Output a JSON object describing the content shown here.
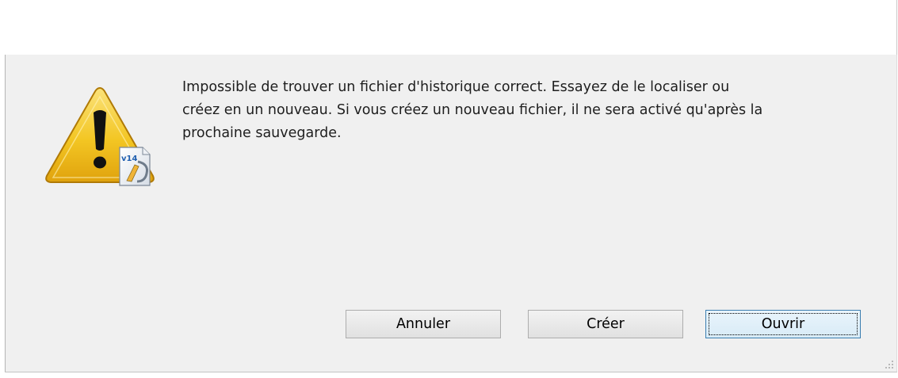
{
  "dialog": {
    "message_lines": [
      "Impossible de trouver un fichier d'historique correct. Essayez de le localiser ou",
      "créez en un nouveau. Si vous créez un nouveau fichier, il ne sera activé qu'après la",
      "prochaine sauvegarde."
    ],
    "icon_name": "warning-icon",
    "icon_badge": "v14",
    "buttons": {
      "cancel_label": "Annuler",
      "create_label": "Créer",
      "open_label": "Ouvrir"
    },
    "colors": {
      "background": "#f0f0f0",
      "warning_fill": "#f3c623",
      "default_button_border": "#3c7fb1"
    }
  }
}
